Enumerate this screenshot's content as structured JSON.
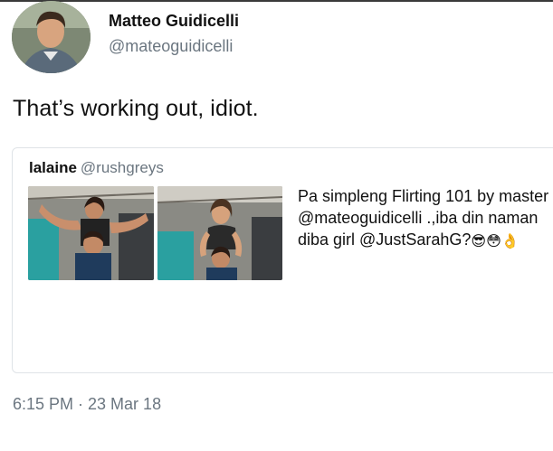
{
  "tweet": {
    "display_name": "Matteo Guidicelli",
    "handle": "@mateoguidicelli",
    "text": "That’s working out, idiot.",
    "timestamp": "6:15 PM · 23 Mar 18"
  },
  "quoted_tweet": {
    "display_name": "lalaine",
    "handle": "@rushgreys",
    "text": "Pa simpleng Flirting 101 by master @mateoguidicelli .,iba din naman diba girl @JustSarahG?",
    "emojis": [
      "😎",
      "😳",
      "👌"
    ],
    "images": [
      "photo-1",
      "photo-2"
    ]
  },
  "colors": {
    "text": "#111111",
    "secondary_text": "#6b7680",
    "card_border": "#dfe3e7",
    "tent_teal": "#2aa0a0"
  }
}
